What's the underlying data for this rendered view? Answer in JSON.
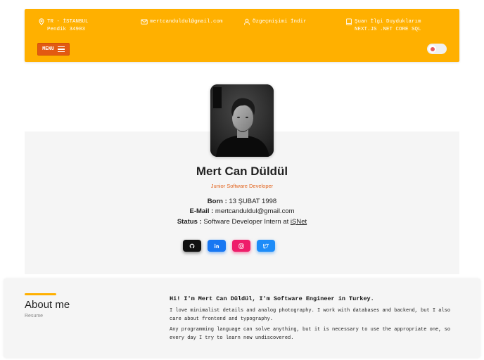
{
  "header": {
    "location": {
      "line1": "TR - İSTANBUL",
      "line2": "Pendik 34903",
      "icon": "location-pin-icon"
    },
    "email": {
      "text": "mertcanduldul@gmail.com",
      "icon": "mail-icon"
    },
    "resume": {
      "text": "Özgeçmişimi İndir",
      "icon": "user-icon"
    },
    "interests": {
      "line1": "Şuan İlgi Duyduklarım",
      "line2": "NEXT.JS .NET CORE SQL",
      "icon": "book-icon"
    },
    "menu_label": "MENU",
    "theme_toggle": {
      "state": "off",
      "icon": "dot-icon"
    },
    "bar_color": "#ffb000",
    "menu_color": "#e25a12"
  },
  "profile": {
    "name": "Mert Can Düldül",
    "role": "Junior Software Developer",
    "born_label": "Born :",
    "born_value": "13 ŞUBAT 1998",
    "email_label": "E-Mail :",
    "email_value": "mertcanduldul@gmail.com",
    "status_label": "Status :",
    "status_value": "Software Developer Intern at",
    "status_link": "iŞNet",
    "socials": [
      {
        "name": "github",
        "icon": "github-icon",
        "color": "#111111"
      },
      {
        "name": "linkedin",
        "icon": "linkedin-icon",
        "color": "#1877f2"
      },
      {
        "name": "instagram",
        "icon": "instagram-icon",
        "color": "#ee1d6a"
      },
      {
        "name": "twitter",
        "icon": "twitter-icon",
        "color": "#1d8cf8"
      }
    ]
  },
  "about": {
    "title": "About me",
    "subtitle": "Resume",
    "headline": "Hi! I'm Mert Can Düldül, I'm Software Engineer in Turkey.",
    "para1_line1": "I love minimalist details and analog photography. I work with databases and backend, but I also",
    "para1_line2": "care about frontend and typography.",
    "para2_line1": "Any programming language can solve anything, but it is necessary to use the appropriate one, so",
    "para2_line2": "every day I try to learn new undiscovered.",
    "accent_color": "#ffb000"
  }
}
